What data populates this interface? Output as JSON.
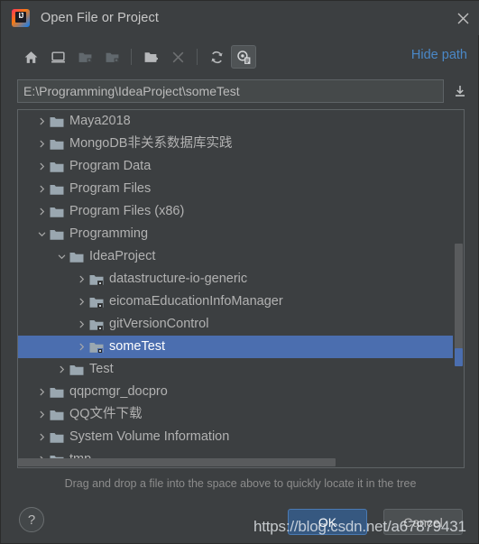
{
  "window": {
    "title": "Open File or Project",
    "app_icon": "intellij-idea-icon",
    "close_icon": "close-icon"
  },
  "toolbar": {
    "buttons": [
      {
        "name": "home-icon",
        "label": "Home",
        "state": "enabled"
      },
      {
        "name": "desktop-icon",
        "label": "Desktop",
        "state": "enabled"
      },
      {
        "name": "project-folder-icon",
        "label": "Project Directory",
        "state": "disabled"
      },
      {
        "name": "module-folder-icon",
        "label": "Module Directory",
        "state": "disabled"
      },
      {
        "name": "new-folder-icon",
        "label": "New Folder",
        "state": "enabled"
      },
      {
        "name": "delete-icon",
        "label": "Delete",
        "state": "disabled"
      },
      {
        "name": "refresh-icon",
        "label": "Refresh",
        "state": "enabled"
      },
      {
        "name": "show-hidden-files-icon",
        "label": "Show Hidden Files",
        "state": "pressed"
      }
    ],
    "hide_path_label": "Hide path"
  },
  "path": {
    "value": "E:\\Programming\\IdeaProject\\someTest",
    "placeholder": "",
    "download_icon": "download-path-icon"
  },
  "tree": {
    "rows": [
      {
        "label": "Maya2018",
        "indent": 1,
        "twisty": "collapsed",
        "icon": "folder-icon",
        "selected": false
      },
      {
        "label": "MongoDB非关系数据库实践",
        "indent": 1,
        "twisty": "collapsed",
        "icon": "folder-icon",
        "selected": false
      },
      {
        "label": "Program Data",
        "indent": 1,
        "twisty": "collapsed",
        "icon": "folder-icon",
        "selected": false
      },
      {
        "label": "Program Files",
        "indent": 1,
        "twisty": "collapsed",
        "icon": "folder-icon",
        "selected": false
      },
      {
        "label": "Program Files (x86)",
        "indent": 1,
        "twisty": "collapsed",
        "icon": "folder-icon",
        "selected": false
      },
      {
        "label": "Programming",
        "indent": 1,
        "twisty": "expanded",
        "icon": "folder-icon",
        "selected": false
      },
      {
        "label": "IdeaProject",
        "indent": 2,
        "twisty": "expanded",
        "icon": "folder-icon",
        "selected": false
      },
      {
        "label": "datastructure-io-generic",
        "indent": 3,
        "twisty": "collapsed",
        "icon": "module-folder-icon",
        "selected": false
      },
      {
        "label": "eicomaEducationInfoManager",
        "indent": 3,
        "twisty": "collapsed",
        "icon": "module-folder-icon",
        "selected": false
      },
      {
        "label": "gitVersionControl",
        "indent": 3,
        "twisty": "collapsed",
        "icon": "module-folder-icon",
        "selected": false
      },
      {
        "label": "someTest",
        "indent": 3,
        "twisty": "collapsed",
        "icon": "module-folder-icon",
        "selected": true
      },
      {
        "label": "Test",
        "indent": 2,
        "twisty": "collapsed",
        "icon": "folder-icon",
        "selected": false
      },
      {
        "label": "qqpcmgr_docpro",
        "indent": 1,
        "twisty": "collapsed",
        "icon": "folder-icon",
        "selected": false
      },
      {
        "label": "QQ文件下载",
        "indent": 1,
        "twisty": "collapsed",
        "icon": "folder-icon",
        "selected": false
      },
      {
        "label": "System Volume Information",
        "indent": 1,
        "twisty": "collapsed",
        "icon": "folder-icon",
        "selected": false
      },
      {
        "label": "tmp",
        "indent": 1,
        "twisty": "collapsed",
        "icon": "folder-icon",
        "selected": false
      }
    ],
    "vertical_scrollbar": "vertical-scrollbar",
    "horizontal_scrollbar": "horizontal-scrollbar"
  },
  "hint": {
    "text": "Drag and drop a file into the space above to quickly locate it in the tree"
  },
  "footer": {
    "help_label": "?",
    "ok_label": "OK",
    "cancel_label": "Cancel"
  },
  "watermark": {
    "text": "https://blog.csdn.net/a67879431"
  },
  "colors": {
    "dialog_background": "#3c3f41",
    "selection_blue": "#4b6eaf",
    "link_blue": "#4a88c7",
    "ok_button_blue": "#365880",
    "text": "#bbbbbb",
    "folder_icon": "#9aa7b0"
  }
}
